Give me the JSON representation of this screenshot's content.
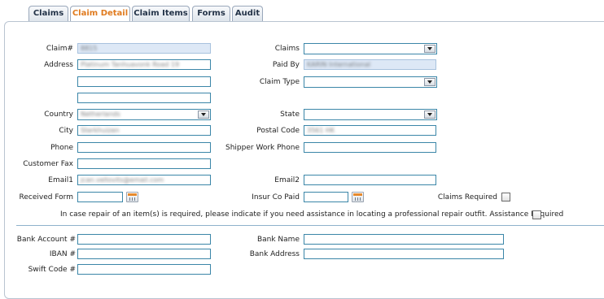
{
  "tabs": [
    "Claims",
    "Claim Detail",
    "Claim Items",
    "Forms",
    "Audit"
  ],
  "active_tab": "Claim Detail",
  "form": {
    "claim_label": "Claim#",
    "claim_value": "8815",
    "address_label": "Address",
    "address_value": "Platinum Tanhuavonk Road 19",
    "country_label": "Country",
    "country_value": "Netherlands",
    "city_label": "City",
    "city_value": "Sterkhuizen",
    "phone_label": "Phone",
    "customer_fax_label": "Customer Fax",
    "email1_label": "Email1",
    "email1_value": "jcan.vellovits@email.com",
    "received_form_label": "Received Form",
    "claims_label": "Claims",
    "paid_by_label": "Paid By",
    "paid_by_value": "KARIN International",
    "claim_type_label": "Claim Type",
    "state_label": "State",
    "postal_code_label": "Postal Code",
    "postal_code_value": "3561 HK",
    "shipper_work_phone_label": "Shipper Work Phone",
    "email2_label": "Email2",
    "insur_co_paid_label": "Insur Co Paid",
    "claims_required_label": "Claims Required",
    "assistance_note": "In case repair of an item(s) is required, please indicate if you need assistance in locating a professional repair outfit. Assistance Required",
    "bank_account_label": "Bank Account #",
    "iban_label": "IBAN #",
    "swift_code_label": "Swift Code #",
    "bank_name_label": "Bank Name",
    "bank_address_label": "Bank Address"
  },
  "icons": {
    "dropdown": "chevron-down-icon",
    "calendar": "calendar-icon",
    "checkbox": "checkbox-icon"
  },
  "colors": {
    "active_tab_text": "#e07b1f",
    "input_border": "#3b86a8",
    "readonly_fill": "#dde8f6"
  }
}
